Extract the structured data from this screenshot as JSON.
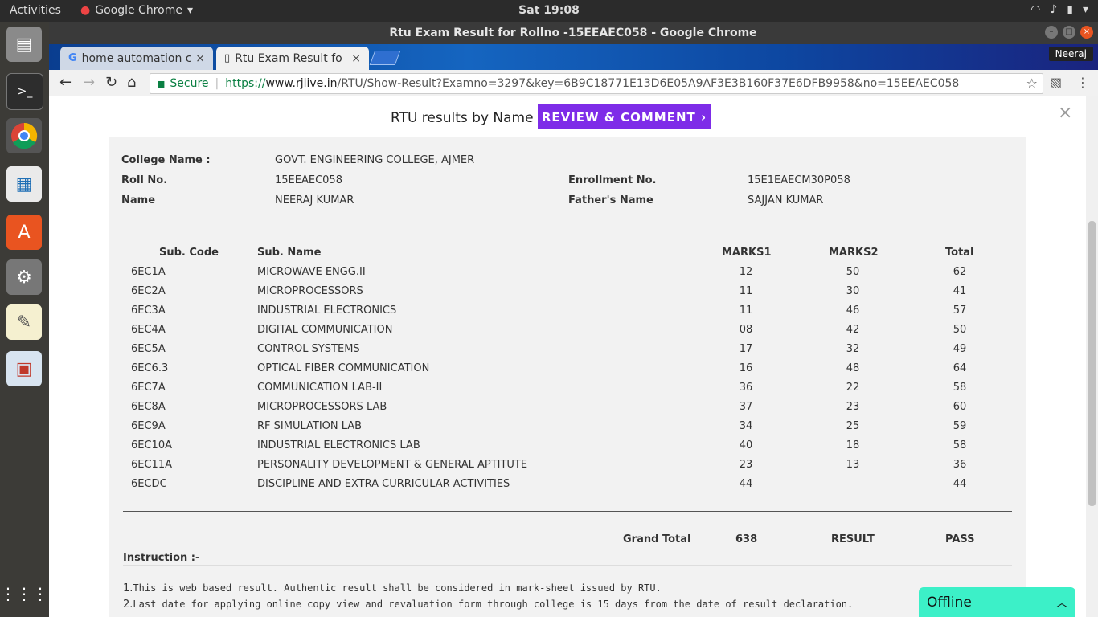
{
  "topbar": {
    "activities": "Activities",
    "app_name": "Google Chrome",
    "clock": "Sat 19:08"
  },
  "dock": {
    "items": [
      "files-icon",
      "terminal-icon",
      "chrome-icon",
      "writer-icon",
      "software-icon",
      "settings-icon",
      "text-editor-icon",
      "impress-icon",
      "apps-grid-icon"
    ]
  },
  "window": {
    "title": "Rtu Exam Result for Rollno -15EEAEC058 - Google Chrome"
  },
  "tabs": [
    {
      "label": "home automation c"
    },
    {
      "label": "Rtu Exam Result for"
    }
  ],
  "user_badge": "Neeraj",
  "omnibox": {
    "secure_label": "Secure",
    "url_scheme": "https://",
    "url_host": "www.rjlive.in",
    "url_path": "/RTU/Show-Result?Examno=3297&key=6B9C18771E13D6E05A9AF3E3B160F37E6DFB9958&no=15EEAEC058"
  },
  "banner": {
    "text": "RTU results by Name",
    "button": "REVIEW & COMMENT ›"
  },
  "student": {
    "college_label": "College Name :",
    "college": "GOVT. ENGINEERING COLLEGE, AJMER",
    "roll_label": "Roll No.",
    "roll": "15EEAEC058",
    "enroll_label": "Enrollment No.",
    "enroll": "15E1EAECM30P058",
    "name_label": "Name",
    "name": "NEERAJ KUMAR",
    "father_label": "Father's Name",
    "father": "SAJJAN KUMAR"
  },
  "table": {
    "headers": [
      "Sub. Code",
      "Sub. Name",
      "MARKS1",
      "MARKS2",
      "Total"
    ],
    "rows": [
      [
        "6EC1A",
        "MICROWAVE ENGG.II",
        "12",
        "50",
        "62"
      ],
      [
        "6EC2A",
        "MICROPROCESSORS",
        "11",
        "30",
        "41"
      ],
      [
        "6EC3A",
        "INDUSTRIAL ELECTRONICS",
        "11",
        "46",
        "57"
      ],
      [
        "6EC4A",
        "DIGITAL COMMUNICATION",
        "08",
        "42",
        "50"
      ],
      [
        "6EC5A",
        "CONTROL SYSTEMS",
        "17",
        "32",
        "49"
      ],
      [
        "6EC6.3",
        "OPTICAL FIBER COMMUNICATION",
        "16",
        "48",
        "64"
      ],
      [
        "6EC7A",
        "COMMUNICATION LAB-II",
        "36",
        "22",
        "58"
      ],
      [
        "6EC8A",
        "MICROPROCESSORS LAB",
        "37",
        "23",
        "60"
      ],
      [
        "6EC9A",
        "RF SIMULATION LAB",
        "34",
        "25",
        "59"
      ],
      [
        "6EC10A",
        "INDUSTRIAL ELECTRONICS LAB",
        "40",
        "18",
        "58"
      ],
      [
        "6EC11A",
        "PERSONALITY DEVELOPMENT & GENERAL APTITUTE",
        "23",
        "13",
        "36"
      ],
      [
        "6ECDC",
        "DISCIPLINE AND EXTRA CURRICULAR ACTIVITIES",
        "44",
        "",
        "44"
      ]
    ]
  },
  "summary": {
    "grand_total_label": "Grand Total",
    "grand_total": "638",
    "result_label": "RESULT",
    "result": "PASS"
  },
  "instructions": {
    "heading": "Instruction :-",
    "items": [
      {
        "n": "1.",
        "text": "This is web based result. Authentic result shall be considered in mark-sheet issued by RTU."
      },
      {
        "n": "2.",
        "text": "Last date for applying online copy view and revaluation form through college is 15 days from the date of result declaration."
      }
    ]
  },
  "chat_widget": {
    "label": "Offline"
  }
}
